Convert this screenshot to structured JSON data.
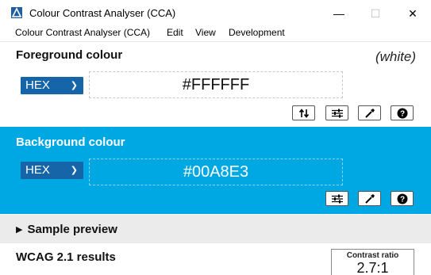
{
  "window": {
    "title": "Colour Contrast Analyser (CCA)",
    "minimize": "—",
    "maximize": "☐",
    "close": "✕"
  },
  "menu": {
    "items": [
      "Colour Contrast Analyser (CCA)",
      "Edit",
      "View",
      "Development"
    ]
  },
  "foreground": {
    "title": "Foreground colour",
    "colour_name": "(white)",
    "format": "HEX",
    "hex_value": "#FFFFFF",
    "tools": [
      "swap-icon",
      "sliders-icon",
      "eyedropper-icon",
      "help-icon"
    ]
  },
  "background": {
    "title": "Background colour",
    "format": "HEX",
    "hex_value": "#00A8E3",
    "section_color": "#00A8E3",
    "tools": [
      "sliders-icon",
      "eyedropper-icon",
      "help-icon"
    ]
  },
  "sample_preview": {
    "label": "Sample preview",
    "expanded": false
  },
  "results": {
    "title": "WCAG 2.1 results",
    "contrast_label": "Contrast ratio",
    "contrast_value": "2.7:1"
  },
  "colors": {
    "accent": "#00A8E3",
    "select_bg": "#1565A8",
    "preview_bar": "#EBEBEB"
  }
}
